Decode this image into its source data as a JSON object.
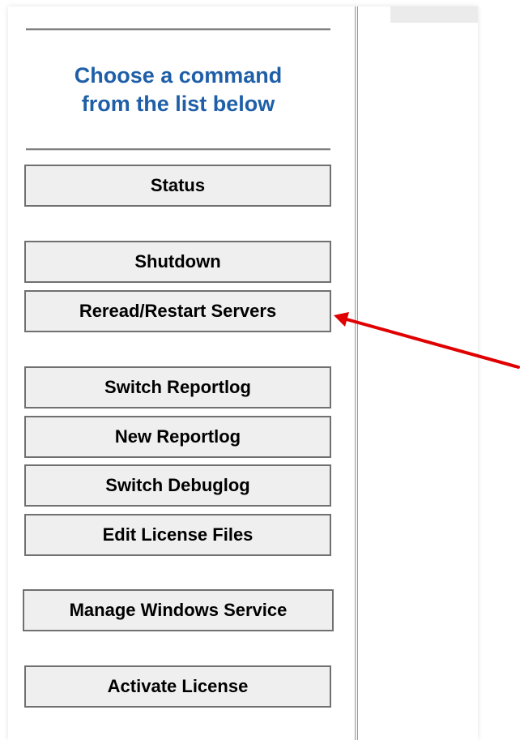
{
  "sidebar": {
    "title": "Choose a command\nfrom the list below",
    "title_line1": "Choose a command",
    "title_line2": "from the list below",
    "buttons": [
      {
        "label": "Status"
      },
      {
        "label": "Shutdown"
      },
      {
        "label": "Reread/Restart Servers"
      },
      {
        "label": "Switch Reportlog"
      },
      {
        "label": "New Reportlog"
      },
      {
        "label": "Switch Debuglog"
      },
      {
        "label": "Edit License Files"
      },
      {
        "label": "Manage Windows Service"
      },
      {
        "label": "Activate License"
      }
    ]
  },
  "colors": {
    "title": "#1f5fa8",
    "button_bg": "#efefef",
    "button_border": "#707070",
    "annotation_arrow": "#e00000"
  },
  "annotation": {
    "type": "arrow",
    "points_to": "Reread/Restart Servers"
  }
}
